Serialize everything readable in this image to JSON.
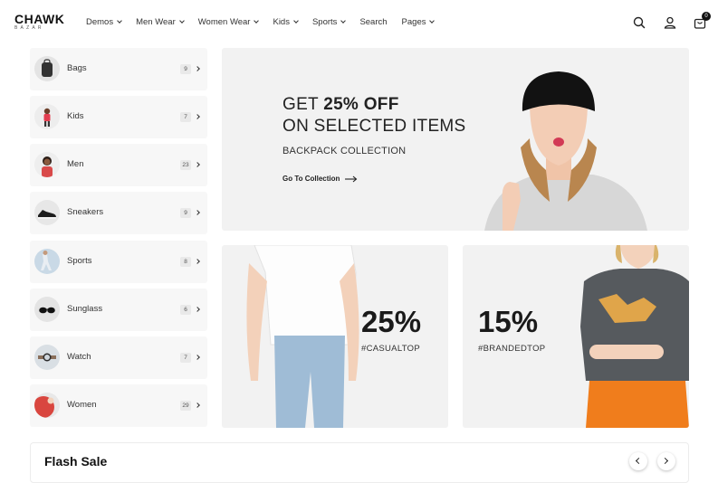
{
  "brand": {
    "logo_main": "CHAWK",
    "logo_sub": "BAZAR"
  },
  "nav": [
    {
      "label": "Demos",
      "has_dropdown": true
    },
    {
      "label": "Men Wear",
      "has_dropdown": true
    },
    {
      "label": "Women Wear",
      "has_dropdown": true
    },
    {
      "label": "Kids",
      "has_dropdown": true
    },
    {
      "label": "Sports",
      "has_dropdown": true
    },
    {
      "label": "Search",
      "has_dropdown": false
    },
    {
      "label": "Pages",
      "has_dropdown": true
    }
  ],
  "header_icons": {
    "search": "search-icon",
    "account": "user-icon",
    "cart": "shopping-bag-icon",
    "cart_count": "0"
  },
  "categories": [
    {
      "label": "Bags",
      "count": "9"
    },
    {
      "label": "Kids",
      "count": "7"
    },
    {
      "label": "Men",
      "count": "23"
    },
    {
      "label": "Sneakers",
      "count": "9"
    },
    {
      "label": "Sports",
      "count": "8"
    },
    {
      "label": "Sunglass",
      "count": "6"
    },
    {
      "label": "Watch",
      "count": "7"
    },
    {
      "label": "Women",
      "count": "29"
    }
  ],
  "hero": {
    "line1_prefix": "GET ",
    "line1_bold": "25% OFF",
    "line2": "ON SELECTED ITEMS",
    "subtitle": "BACKPACK COLLECTION",
    "link": "Go To Collection"
  },
  "promos": [
    {
      "percent": "25%",
      "tag": "#CASUALTOP"
    },
    {
      "percent": "15%",
      "tag": "#BRANDEDTOP"
    }
  ],
  "flash_sale": {
    "title": "Flash Sale"
  },
  "colors": {
    "panel": "#f2f2f2",
    "sidebar": "#f7f7f7",
    "text": "#1f1f1f",
    "accent_orange": "#f07d1c"
  }
}
